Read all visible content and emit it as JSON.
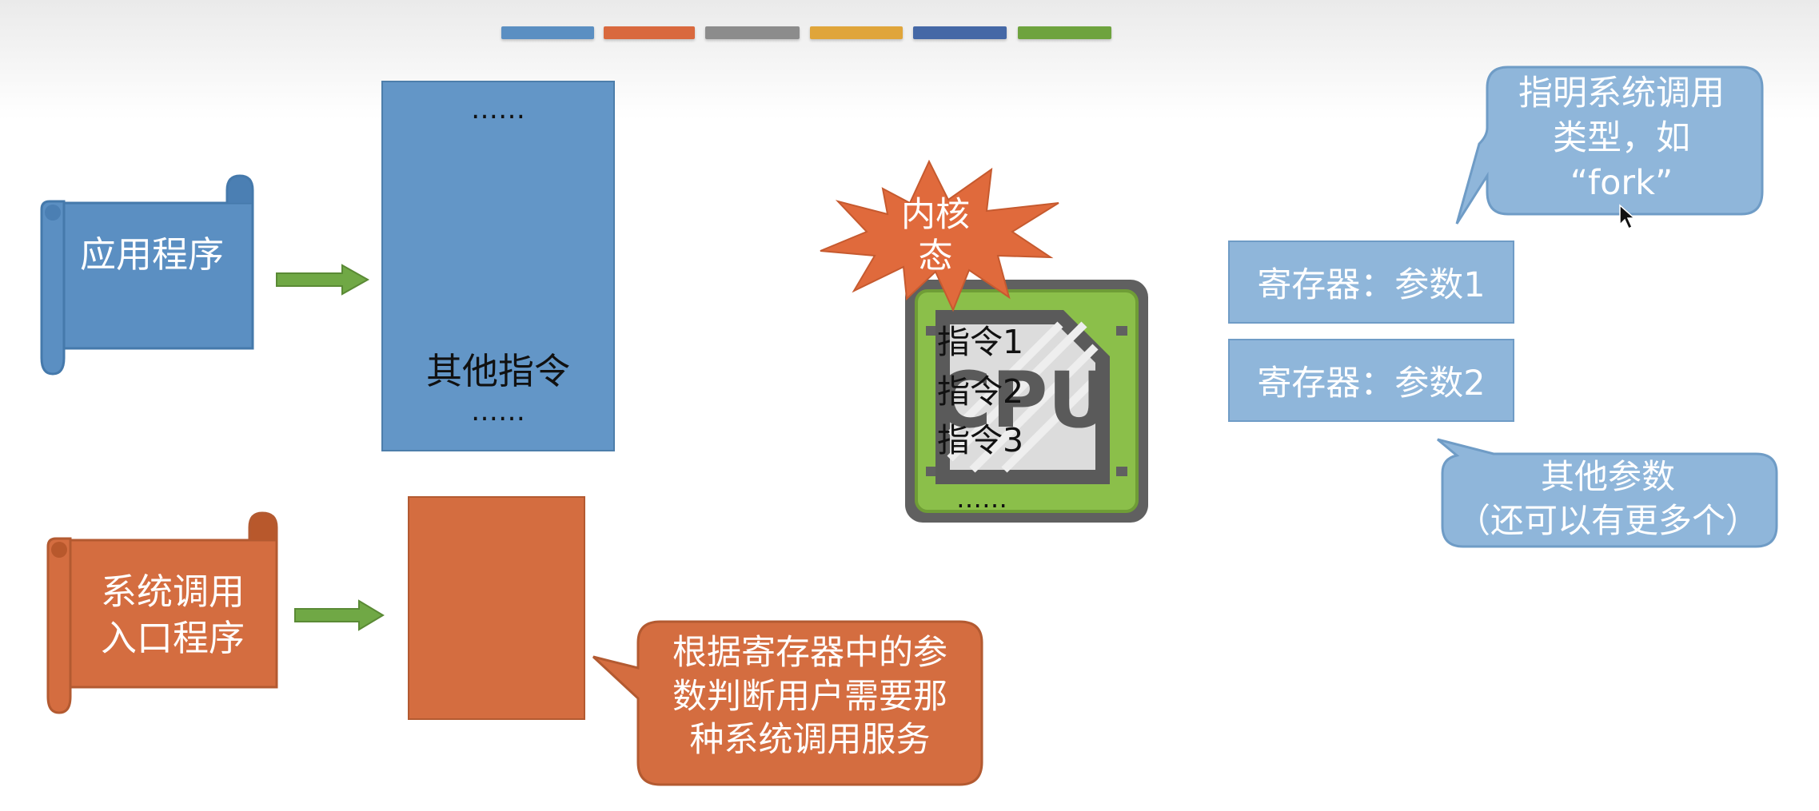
{
  "color_bars": [
    "#5b8fc2",
    "#d9693e",
    "#8c8c8c",
    "#e0a53a",
    "#4568a6",
    "#6ea33e"
  ],
  "app_scroll": {
    "label": "应用程序"
  },
  "syscall_scroll": {
    "label": "系统调用\n入口程序"
  },
  "app_block": {
    "top_dots": "……",
    "other_label": "其他指令",
    "bottom_dots": "……"
  },
  "kernel_burst": {
    "label": "内核\n态"
  },
  "cpu": {
    "chip_text": "CPU",
    "instructions": [
      "指令1",
      "指令2",
      "指令3"
    ],
    "dots": "……"
  },
  "registers": [
    "寄存器：参数1",
    "寄存器：参数2"
  ],
  "callout_type": {
    "text": "指明系统调用\n类型，如\n“fork”"
  },
  "callout_other": {
    "text": "其他参数\n（还可以有更多个）"
  },
  "callout_syscall": {
    "text": "根据寄存器中的参\n数判断用户需要那\n种系统调用服务"
  }
}
